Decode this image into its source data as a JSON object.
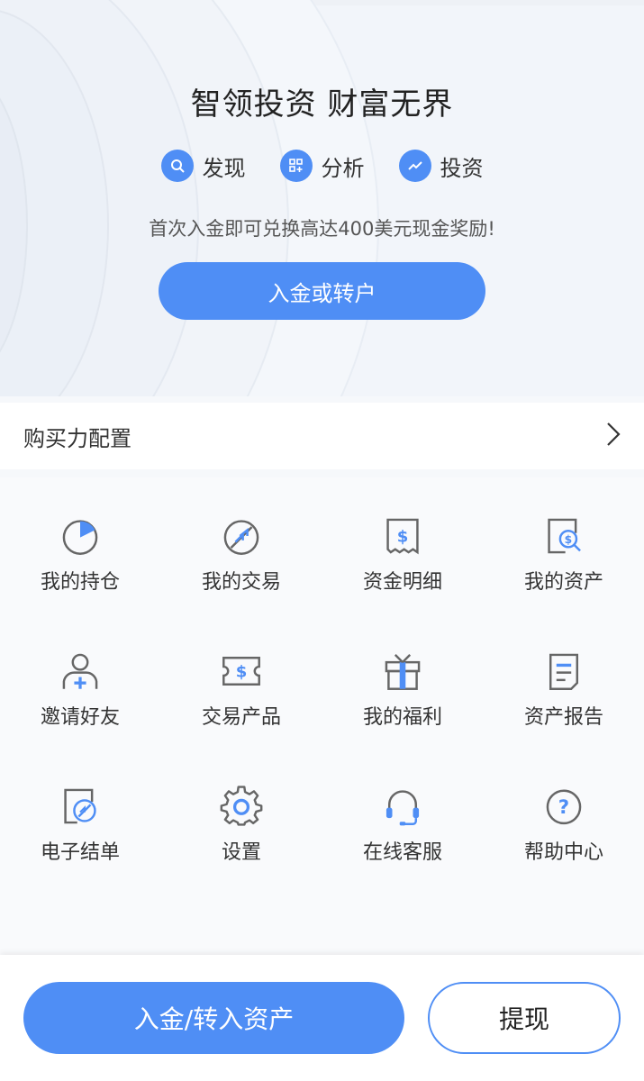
{
  "hero": {
    "title": "智领投资 财富无界",
    "features": [
      {
        "label": "发现",
        "icon": "search-icon"
      },
      {
        "label": "分析",
        "icon": "grid-plus-icon"
      },
      {
        "label": "投资",
        "icon": "trend-line-icon"
      }
    ],
    "promo": "首次入金即可兑换高达400美元现金奖励!",
    "deposit_button": "入金或转户"
  },
  "buying_power": {
    "label": "购买力配置",
    "icon": "chevron-right-icon"
  },
  "menu": {
    "items": [
      {
        "label": "我的持仓",
        "icon": "pie-chart-icon"
      },
      {
        "label": "我的交易",
        "icon": "exchange-icon"
      },
      {
        "label": "资金明细",
        "icon": "receipt-dollar-icon"
      },
      {
        "label": "我的资产",
        "icon": "asset-search-icon"
      },
      {
        "label": "邀请好友",
        "icon": "add-user-icon"
      },
      {
        "label": "交易产品",
        "icon": "dollar-ticket-icon"
      },
      {
        "label": "我的福利",
        "icon": "gift-icon"
      },
      {
        "label": "资产报告",
        "icon": "report-icon"
      },
      {
        "label": "电子结单",
        "icon": "statement-icon"
      },
      {
        "label": "设置",
        "icon": "gear-icon"
      },
      {
        "label": "在线客服",
        "icon": "headset-icon"
      },
      {
        "label": "帮助中心",
        "icon": "help-icon"
      }
    ]
  },
  "bottom": {
    "transfer_button": "入金/转入资产",
    "withdraw_button": "提现"
  },
  "colors": {
    "accent": "#4f8ef5",
    "icon_gray": "#666666",
    "background": "#f6f8fb"
  }
}
